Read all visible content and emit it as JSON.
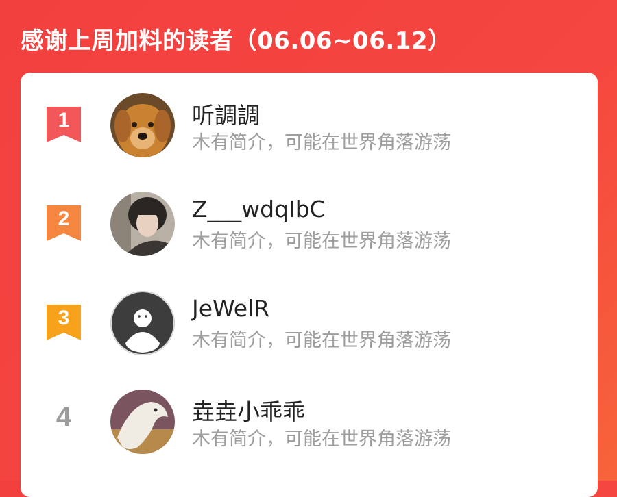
{
  "header": {
    "title": "感谢上周加料的读者（06.06~06.12）"
  },
  "colors": {
    "background_red": "#f2403f",
    "rank1": "#f2585a",
    "rank2": "#f5863f",
    "rank3": "#f7a21a",
    "rank_plain": "#9b9b9b"
  },
  "readers": [
    {
      "rank": "1",
      "name": "听調調",
      "bio": "木有简介，可能在世界角落游荡",
      "avatar_icon": "golden-retriever-avatar"
    },
    {
      "rank": "2",
      "name": "Z___wdqIbC",
      "bio": "木有简介，可能在世界角落游荡",
      "avatar_icon": "person-portrait-avatar"
    },
    {
      "rank": "3",
      "name": "JeWelR",
      "bio": "木有简介，可能在世界角落游荡",
      "avatar_icon": "default-ghost-avatar"
    },
    {
      "rank": "4",
      "name": "垚垚小乖乖",
      "bio": "木有简介，可能在世界角落游荡",
      "avatar_icon": "white-horse-avatar"
    }
  ]
}
